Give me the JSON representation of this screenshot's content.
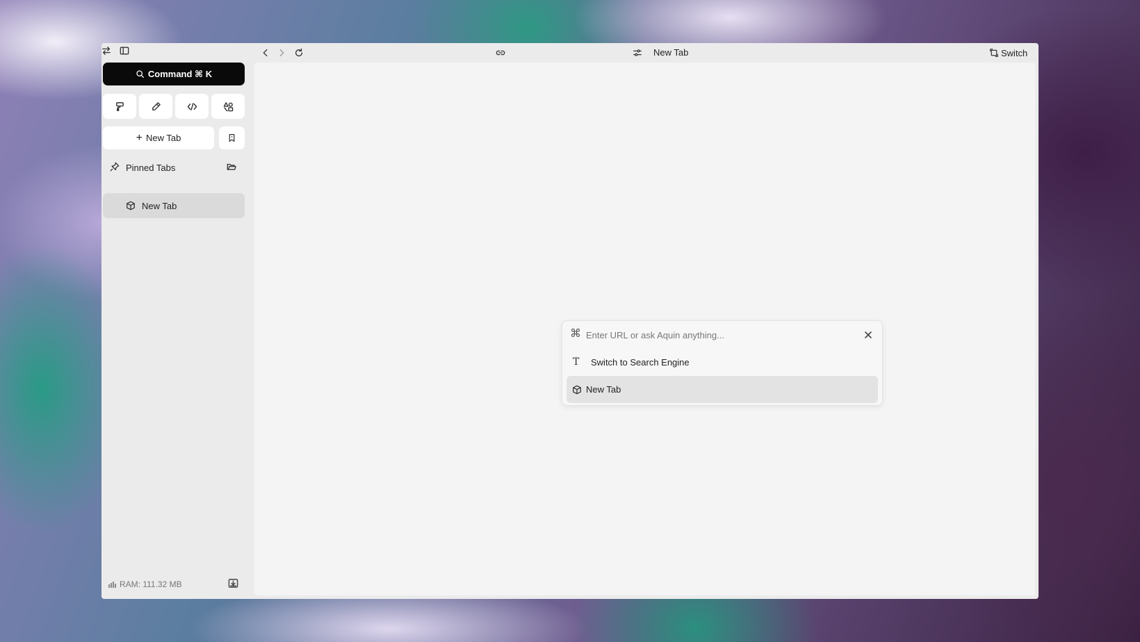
{
  "sidebar": {
    "command_label": "Command ⌘ K",
    "new_tab_label": "New Tab",
    "pinned_label": "Pinned Tabs",
    "tabs": [
      {
        "label": "New Tab"
      }
    ],
    "ram_label": "RAM: 111.32 MB"
  },
  "topbar": {
    "title": "New Tab",
    "switch_label": "Switch"
  },
  "palette": {
    "placeholder": "Enter URL or ask Aquin anything...",
    "value": "",
    "items": [
      {
        "label": "Switch to Search Engine",
        "icon": "text-t-icon"
      },
      {
        "label": "New Tab",
        "icon": "cube-icon"
      }
    ]
  },
  "icons": [
    "swap-icon",
    "sidebar-toggle-icon",
    "search-icon",
    "paint-roller-icon",
    "pen-icon",
    "code-icon",
    "shapes-icon",
    "plus-icon",
    "bookmark-icon",
    "pin-icon",
    "folder-icon",
    "cube-icon",
    "ram-bars-icon",
    "download-icon",
    "back-icon",
    "forward-icon",
    "reload-icon",
    "link-icon",
    "sliders-icon",
    "switch-icon",
    "split-view-icon",
    "minimize-icon",
    "maximize-icon",
    "close-icon",
    "command-icon"
  ]
}
